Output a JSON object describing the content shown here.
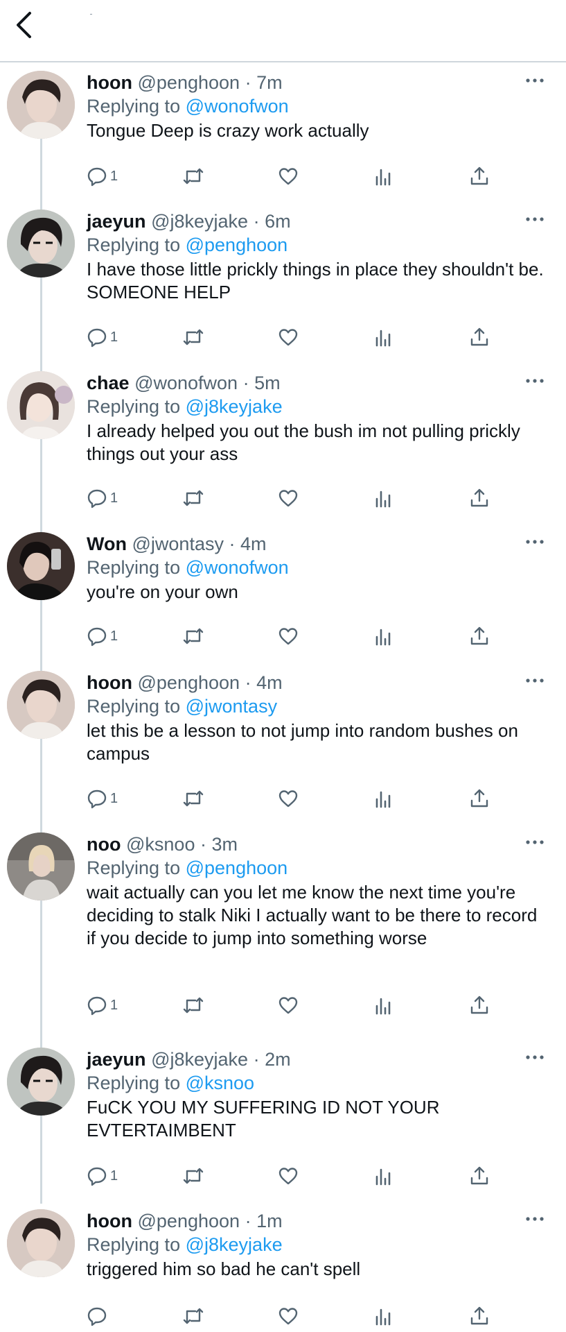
{
  "header": {
    "back_icon": "chevron-left-icon"
  },
  "colors": {
    "mention": "#1d9bf0",
    "secondary_text": "#536471",
    "primary_text": "#0f1419",
    "thread_line": "#cfd9de"
  },
  "tweets": [
    {
      "name": "hoon",
      "handle": "@penghoon",
      "separator": "·",
      "time": "7m",
      "replying_prefix": "Replying to",
      "replying_to": "@wonofwon",
      "text": "Tongue Deep is crazy work actually",
      "reply_count": "1"
    },
    {
      "name": "jaeyun",
      "handle": "@j8keyjake",
      "separator": "·",
      "time": "6m",
      "replying_prefix": "Replying to",
      "replying_to": "@penghoon",
      "text": "I have those little prickly things in place they shouldn't be. SOMEONE HELP",
      "reply_count": "1"
    },
    {
      "name": "chae",
      "handle": "@wonofwon",
      "separator": "·",
      "time": "5m",
      "replying_prefix": "Replying to",
      "replying_to": "@j8keyjake",
      "text": "I already helped you out the bush im not pulling prickly things out your ass",
      "reply_count": "1"
    },
    {
      "name": "Won",
      "handle": "@jwontasy",
      "separator": "·",
      "time": "4m",
      "replying_prefix": "Replying to",
      "replying_to": "@wonofwon",
      "text": "you're on your own",
      "reply_count": "1"
    },
    {
      "name": "hoon",
      "handle": "@penghoon",
      "separator": "·",
      "time": "4m",
      "replying_prefix": "Replying to",
      "replying_to": "@jwontasy",
      "text": "let this be a lesson to not jump into random bushes on campus",
      "reply_count": "1"
    },
    {
      "name": "noo",
      "handle": "@ksnoo",
      "separator": "·",
      "time": "3m",
      "replying_prefix": "Replying to",
      "replying_to": "@penghoon",
      "text": "wait actually can you let me know the next time you're deciding to stalk Niki I actually want to be there to record if you decide to jump into something worse",
      "reply_count": "1"
    },
    {
      "name": "jaeyun",
      "handle": "@j8keyjake",
      "separator": "·",
      "time": "2m",
      "replying_prefix": "Replying to",
      "replying_to": "@ksnoo",
      "text": "FuCK YOU MY SUFFERING ID NOT YOUR EVTERTAIMBENT",
      "reply_count": "1"
    },
    {
      "name": "hoon",
      "handle": "@penghoon",
      "separator": "·",
      "time": "1m",
      "replying_prefix": "Replying to",
      "replying_to": "@j8keyjake",
      "text": "triggered him so bad he can't spell",
      "reply_count": ""
    }
  ]
}
